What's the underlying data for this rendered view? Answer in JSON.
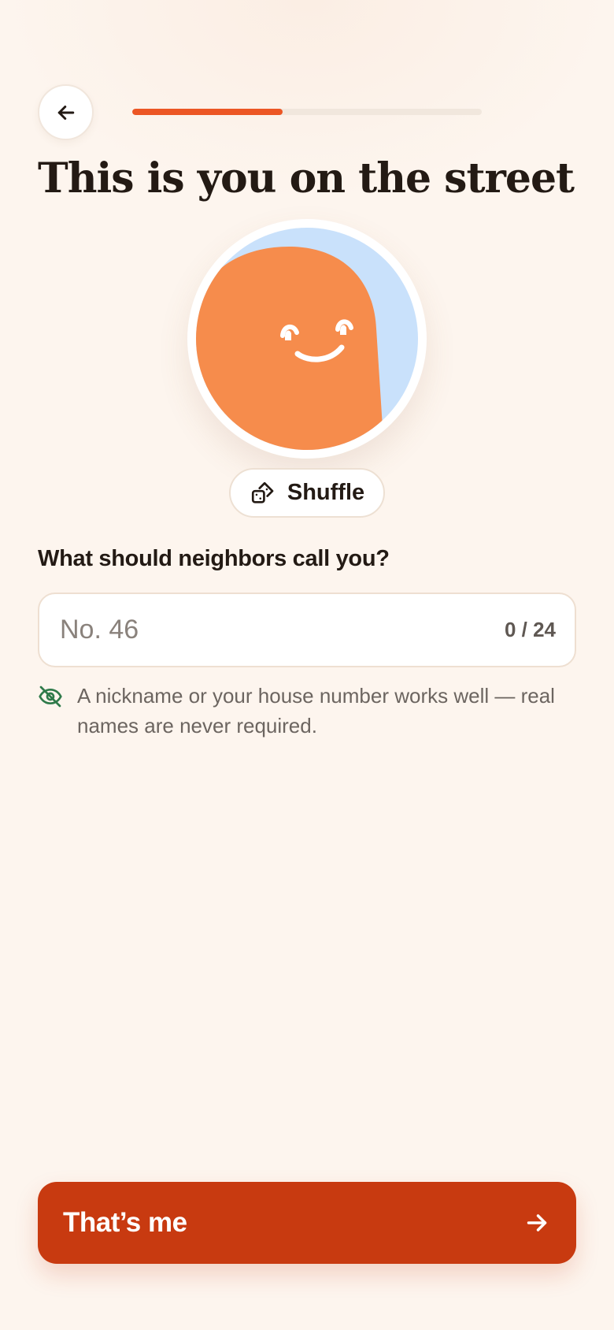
{
  "header": {
    "back_icon": "arrow-left-icon",
    "progress": 0.43
  },
  "title": "This is you on the street",
  "avatar": {
    "face_color": "#f68c4c",
    "background_color": "#c9e1fb"
  },
  "shuffle": {
    "icon": "dice-icon",
    "label": "Shuffle"
  },
  "name": {
    "question": "What should neighbors call you?",
    "placeholder": "No. 46",
    "value": "",
    "counter": "0 / 24"
  },
  "hint": {
    "icon": "eye-off-icon",
    "text": "A nickname or your house number works well — real names are never required."
  },
  "cta": {
    "label": "That’s me",
    "icon": "arrow-right-icon"
  },
  "colors": {
    "accent": "#ec5624",
    "cta": "#c83a10",
    "hint_icon": "#2f7a4a",
    "background": "#fdf5ee"
  }
}
